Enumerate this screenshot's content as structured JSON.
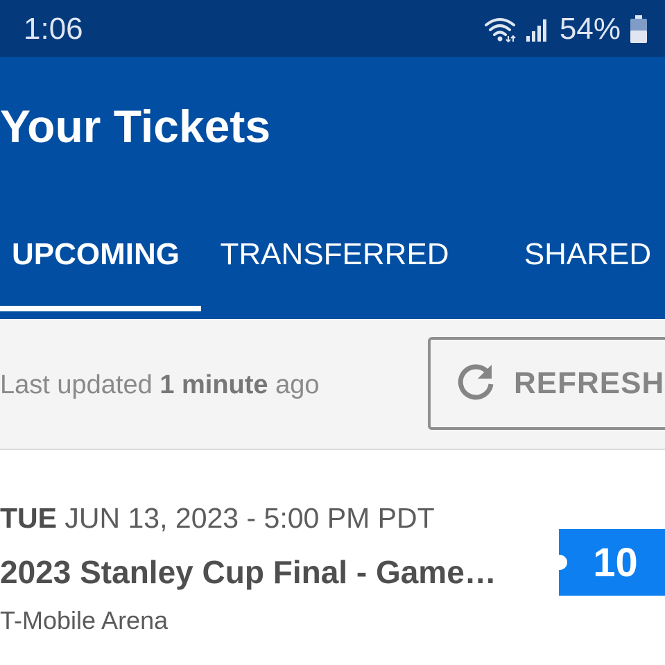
{
  "status_bar": {
    "time": "1:06",
    "battery_percent": "54%",
    "icons": [
      "wifi-icon",
      "signal-icon",
      "battery-icon"
    ]
  },
  "header": {
    "title": "Your Tickets"
  },
  "tabs": [
    {
      "label": "UPCOMING",
      "selected": true
    },
    {
      "label": "TRANSFERRED",
      "selected": false
    },
    {
      "label": "SHARED",
      "selected": false
    }
  ],
  "update_bar": {
    "prefix": "Last updated ",
    "value": "1 minute",
    "suffix": " ago",
    "refresh_label": "REFRESH",
    "refresh_icon": "refresh-icon"
  },
  "events": [
    {
      "day": "TUE",
      "datetime": " JUN 13, 2023 - 5:00 PM PDT",
      "title": "2023 Stanley Cup Final - Game…",
      "venue": "T-Mobile Arena",
      "ticket_count": "10"
    }
  ],
  "colors": {
    "status_bar": "#043a7c",
    "header": "#024ea2",
    "badge": "#0d7ff0",
    "background_light": "#f4f4f4"
  }
}
